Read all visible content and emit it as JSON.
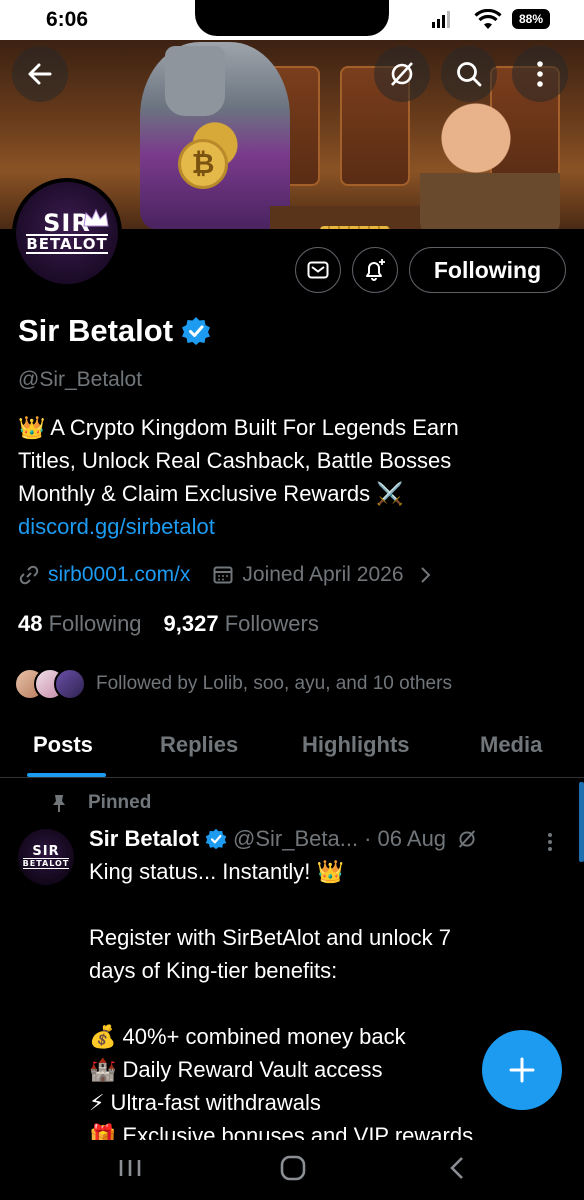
{
  "status_bar": {
    "time": "6:06",
    "battery": "88%"
  },
  "profile": {
    "name": "Sir Betalot",
    "handle": "@Sir_Betalot",
    "logo_line1": "SIR",
    "logo_line2": "BETALOT",
    "bio_line1": "👑 A Crypto Kingdom Built For Legends  Earn",
    "bio_line2": "Titles, Unlock Real Cashback, Battle Bosses",
    "bio_line3": "Monthly & Claim Exclusive Rewards ⚔️",
    "bio_link": "discord.gg/sirbetalot",
    "website": "sirb0001.com/x",
    "joined": "Joined April 2026",
    "following_count": "48",
    "following_label": "Following",
    "followers_count": "9,327",
    "followers_label": "Followers",
    "followed_by": "Followed by Lolib, soo, ayu, and 10 others"
  },
  "actions": {
    "follow_label": "Following"
  },
  "banner": {
    "coin_symbol": "₿"
  },
  "tabs": [
    {
      "label": "Posts"
    },
    {
      "label": "Replies"
    },
    {
      "label": "Highlights"
    },
    {
      "label": "Media"
    }
  ],
  "post": {
    "pinned_label": "Pinned",
    "author": "Sir Betalot",
    "handle": "@Sir_Beta...",
    "date": "· 06 Aug",
    "line1": "King status... Instantly! 👑",
    "line2": "Register with SirBetAlot and unlock 7",
    "line3": "days of King-tier benefits:",
    "line4": "💰 40%+ combined money back",
    "line5": "🏰 Daily Reward Vault access",
    "line6": "⚡ Ultra-fast withdrawals",
    "line7": "🎁 Exclusive bonuses and VIP rewards"
  },
  "colors": {
    "accent": "#1d9bf0",
    "background": "#000000",
    "muted": "#71767b"
  }
}
